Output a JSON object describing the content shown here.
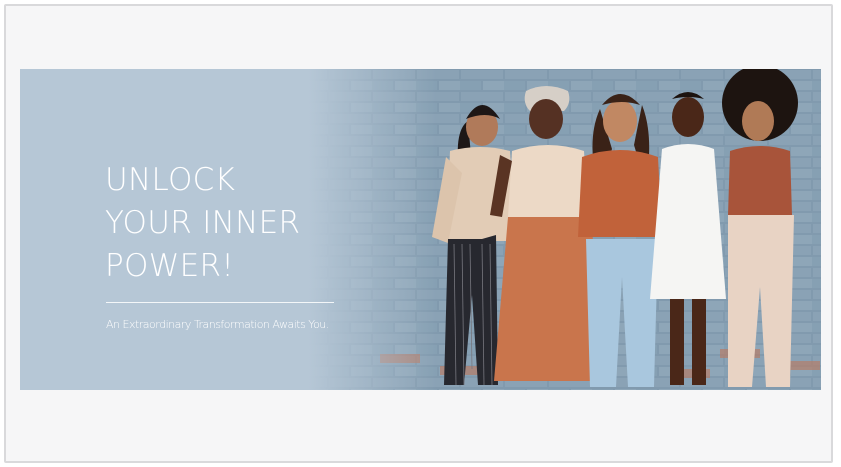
{
  "hero": {
    "headline": "UNLOCK\nYOUR INNER\nPOWER!",
    "subtitle": "An Extraordinary Transformation Awaits You."
  },
  "colors": {
    "banner_background": "#b6c7d6",
    "text": "#ffffff",
    "wall": "#7f98ac"
  },
  "image": {
    "subject": "five smiling women standing together in front of a painted blue brick wall"
  }
}
